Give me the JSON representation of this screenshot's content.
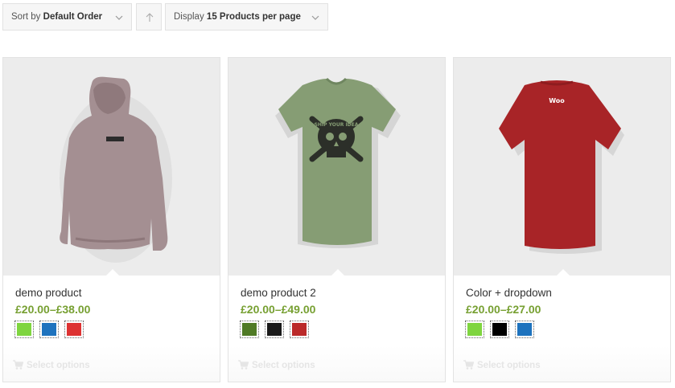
{
  "toolbar": {
    "sort_prefix": "Sort by",
    "sort_value": "Default Order",
    "display_prefix": "Display",
    "display_value": "15 Products per page"
  },
  "products": [
    {
      "name": "demo product",
      "price": "£20.00–£38.00",
      "swatches": [
        "#7fd540",
        "#1e73be",
        "#dd3333"
      ],
      "image": "hoodie-back",
      "action": "Select options"
    },
    {
      "name": "demo product 2",
      "price": "£20.00–£49.00",
      "swatches": [
        "#4f7a25",
        "#1a1a1a",
        "#bb2a2a"
      ],
      "image": "green-skull-tshirt",
      "action": "Select options"
    },
    {
      "name": "Color + dropdown",
      "price": "£20.00–£27.00",
      "swatches": [
        "#7fd540",
        "#000000",
        "#1e73be"
      ],
      "image": "red-woo-tshirt",
      "action": "Select options"
    }
  ],
  "tshirt_print": {
    "skull_text": "SHIP YOUR IDEA",
    "woo_text": "Woo"
  }
}
